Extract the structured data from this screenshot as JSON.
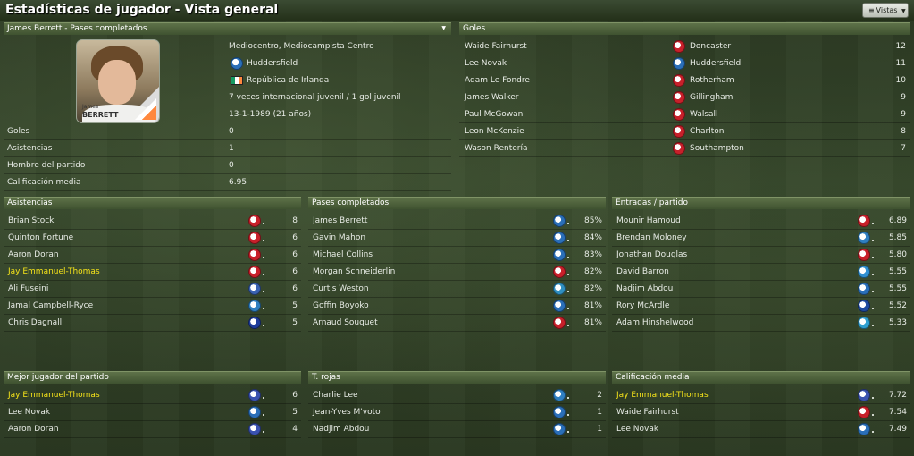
{
  "title": "Estadísticas de jugador - Vista general",
  "views_button": "Vistas",
  "profile": {
    "header": "James Berrett - Pases completados",
    "photo_first": "James",
    "photo_last": "BERRETT",
    "position": "Mediocentro, Mediocampista Centro",
    "club": "Huddersfield",
    "nation": "República de Irlanda",
    "caps": "7 veces internacional juvenil / 1 gol juvenil",
    "dob": "13-1-1989 (21 años)",
    "stats": [
      {
        "label": "Goles",
        "value": "0"
      },
      {
        "label": "Asistencias",
        "value": "1"
      },
      {
        "label": "Hombre del partido",
        "value": "0"
      },
      {
        "label": "Calificación media",
        "value": "6.95"
      }
    ]
  },
  "goals": {
    "header": "Goles",
    "rows": [
      {
        "name": "Waide Fairhurst",
        "club": "Doncaster",
        "value": "12",
        "crest": "#c8202a"
      },
      {
        "name": "Lee Novak",
        "club": "Huddersfield",
        "value": "11",
        "crest": "#2a6fb8"
      },
      {
        "name": "Adam Le Fondre",
        "club": "Rotherham",
        "value": "10",
        "crest": "#c8202a"
      },
      {
        "name": "James Walker",
        "club": "Gillingham",
        "value": "9",
        "crest": "#c8202a"
      },
      {
        "name": "Paul McGowan",
        "club": "Walsall",
        "value": "9",
        "crest": "#c8202a"
      },
      {
        "name": "Leon McKenzie",
        "club": "Charlton",
        "value": "8",
        "crest": "#c8202a"
      },
      {
        "name": "Wason Rentería",
        "club": "Southampton",
        "value": "7",
        "crest": "#c8202a"
      }
    ]
  },
  "assists": {
    "header": "Asistencias",
    "rows": [
      {
        "name": "Brian Stock",
        "value": "8",
        "crest": "#c8202a",
        "highlight": false
      },
      {
        "name": "Quinton Fortune",
        "value": "6",
        "crest": "#c8202a",
        "highlight": false
      },
      {
        "name": "Aaron Doran",
        "value": "6",
        "crest": "#c8202a",
        "highlight": false
      },
      {
        "name": "Jay Emmanuel-Thomas",
        "value": "6",
        "crest": "#c8202a",
        "highlight": true
      },
      {
        "name": "Ali Fuseini",
        "value": "6",
        "crest": "#3a62b0",
        "highlight": false
      },
      {
        "name": "Jamal Campbell-Ryce",
        "value": "5",
        "crest": "#2f7fc0",
        "highlight": false
      },
      {
        "name": "Chris Dagnall",
        "value": "5",
        "crest": "#1e3c9a",
        "highlight": false
      }
    ]
  },
  "passes": {
    "header": "Pases completados",
    "rows": [
      {
        "name": "James Berrett",
        "value": "85%",
        "crest": "#2a6fb8"
      },
      {
        "name": "Gavin Mahon",
        "value": "84%",
        "crest": "#2a6fb8"
      },
      {
        "name": "Michael Collins",
        "value": "83%",
        "crest": "#2a6fb8"
      },
      {
        "name": "Morgan Schneiderlin",
        "value": "82%",
        "crest": "#c8202a"
      },
      {
        "name": "Curtis Weston",
        "value": "82%",
        "crest": "#2f8fc0"
      },
      {
        "name": "Goffin Boyoko",
        "value": "81%",
        "crest": "#2a6fb8"
      },
      {
        "name": "Arnaud Souquet",
        "value": "81%",
        "crest": "#c8202a"
      }
    ]
  },
  "tackles": {
    "header": "Entradas / partido",
    "rows": [
      {
        "name": "Mounir Hamoud",
        "value": "6.89",
        "crest": "#c8202a"
      },
      {
        "name": "Brendan Moloney",
        "value": "5.85",
        "crest": "#2f7fc0"
      },
      {
        "name": "Jonathan Douglas",
        "value": "5.80",
        "crest": "#c8202a"
      },
      {
        "name": "David Barron",
        "value": "5.55",
        "crest": "#2f8fd0"
      },
      {
        "name": "Nadjim Abdou",
        "value": "5.55",
        "crest": "#2a6fb8"
      },
      {
        "name": "Rory McArdle",
        "value": "5.52",
        "crest": "#1e4aa0"
      },
      {
        "name": "Adam Hinshelwood",
        "value": "5.33",
        "crest": "#2f9fd0"
      }
    ]
  },
  "motm": {
    "header": "Mejor jugador del partido",
    "rows": [
      {
        "name": "Jay Emmanuel-Thomas",
        "value": "6",
        "crest": "#3a52b0",
        "highlight": true
      },
      {
        "name": "Lee Novak",
        "value": "5",
        "crest": "#2a6fb8",
        "highlight": false
      },
      {
        "name": "Aaron Doran",
        "value": "4",
        "crest": "#3a52b0",
        "highlight": false
      }
    ]
  },
  "reds": {
    "header": "T. rojas",
    "rows": [
      {
        "name": "Charlie Lee",
        "value": "2",
        "crest": "#2f7fc0"
      },
      {
        "name": "Jean-Yves M'voto",
        "value": "1",
        "crest": "#2a6fb8"
      },
      {
        "name": "Nadjim Abdou",
        "value": "1",
        "crest": "#2a6fb8"
      }
    ]
  },
  "rating": {
    "header": "Calificación media",
    "rows": [
      {
        "name": "Jay Emmanuel-Thomas",
        "value": "7.72",
        "crest": "#3a52b0",
        "highlight": true
      },
      {
        "name": "Waide Fairhurst",
        "value": "7.54",
        "crest": "#c8202a",
        "highlight": false
      },
      {
        "name": "Lee Novak",
        "value": "7.49",
        "crest": "#2a6fb8",
        "highlight": false
      }
    ]
  }
}
